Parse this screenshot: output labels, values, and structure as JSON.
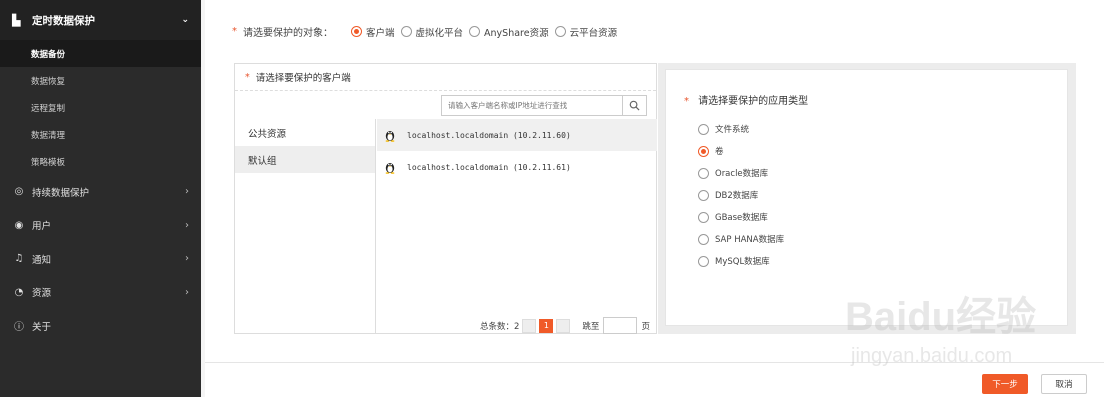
{
  "sidebar": {
    "header": {
      "icon": "backup-icon",
      "label": "定时数据保护"
    },
    "sub_items": [
      {
        "label": "数据备份",
        "active": true
      },
      {
        "label": "数据恢复"
      },
      {
        "label": "远程复制"
      },
      {
        "label": "数据清理"
      },
      {
        "label": "策略模板"
      }
    ],
    "nav": [
      {
        "icon": "continuous-icon",
        "label": "持续数据保护"
      },
      {
        "icon": "user-icon",
        "label": "用户"
      },
      {
        "icon": "bell-icon",
        "label": "通知"
      },
      {
        "icon": "pie-icon",
        "label": "资源"
      },
      {
        "icon": "info-icon",
        "label": "关于"
      }
    ]
  },
  "object": {
    "label": "请选要保护的对象：",
    "options": [
      {
        "label": "客户端",
        "selected": true
      },
      {
        "label": "虚拟化平台"
      },
      {
        "label": "AnyShare资源"
      },
      {
        "label": "云平台资源"
      }
    ]
  },
  "client_panel": {
    "title": "请选择要保护的客户端",
    "search_placeholder": "请输入客户端名称或IP地址进行查找",
    "groups": [
      {
        "label": "公共资源"
      },
      {
        "label": "默认组",
        "selected": true
      }
    ],
    "clients": [
      {
        "label": "localhost.localdomain (10.2.11.60)"
      },
      {
        "label": "localhost.localdomain (10.2.11.61)"
      }
    ],
    "pager": {
      "total_label": "总条数：2",
      "page": "1",
      "goto_label": "跳至",
      "page_suffix": "页"
    }
  },
  "app_panel": {
    "title": "请选择要保护的应用类型",
    "options": [
      {
        "label": "文件系统"
      },
      {
        "label": "卷",
        "selected": true
      },
      {
        "label": "Oracle数据库"
      },
      {
        "label": "DB2数据库"
      },
      {
        "label": "GBase数据库"
      },
      {
        "label": "SAP HANA数据库"
      },
      {
        "label": "MySQL数据库"
      }
    ]
  },
  "footer": {
    "next_label": "下一步",
    "cancel_label": "取消"
  },
  "watermark": {
    "text": "Baidu经验",
    "url": "jingyan.baidu.com"
  },
  "colors": {
    "accent": "#f05a28",
    "sidebar_bg": "#2b2b2b"
  }
}
